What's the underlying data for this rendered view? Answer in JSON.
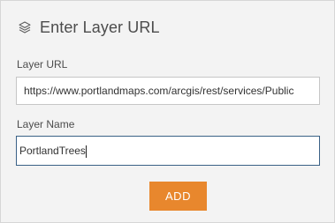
{
  "panel": {
    "title": "Enter Layer URL",
    "title_icon": "layers-icon"
  },
  "form": {
    "url_label": "Layer URL",
    "url_value": "https://www.portlandmaps.com/arcgis/rest/services/Public",
    "name_label": "Layer Name",
    "name_value": "PortlandTrees",
    "add_label": "ADD"
  },
  "colors": {
    "accent": "#e8872d",
    "focus_border": "#3a6186",
    "panel_bg": "#f3f3f3"
  }
}
